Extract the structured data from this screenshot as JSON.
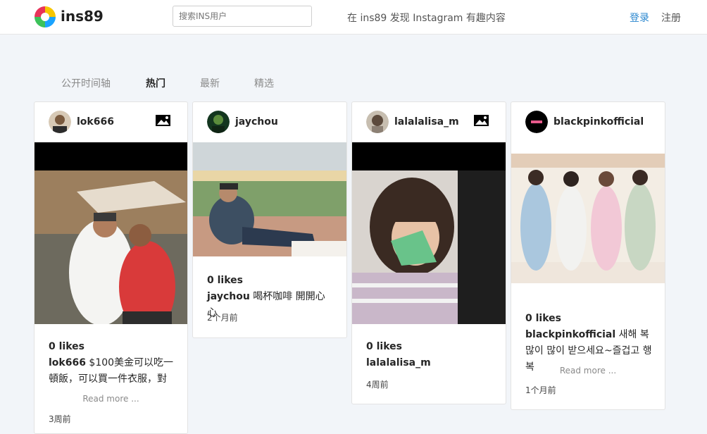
{
  "header": {
    "brand": "ins89",
    "search_placeholder": "搜索INS用户",
    "slogan": "在 ins89 发现 Instagram 有趣内容",
    "login": "登录",
    "register": "注册"
  },
  "tabs": [
    {
      "label": "公开时间轴",
      "active": false
    },
    {
      "label": "热门",
      "active": true
    },
    {
      "label": "最新",
      "active": false
    },
    {
      "label": "精选",
      "active": false
    }
  ],
  "posts": [
    {
      "username": "lok666",
      "likes": "0 likes",
      "caption_user": "lok666",
      "caption_text": "$100美金可以吃一頓飯，可以買一件衣服，對",
      "read_more": "Read more ...",
      "time": "3周前",
      "multi_image": true
    },
    {
      "username": "jaychou",
      "likes": "0 likes",
      "caption_user": "jaychou",
      "caption_text": "喝杯咖啡 開開心心",
      "time": "2个月前",
      "multi_image": false
    },
    {
      "username": "lalalalisa_m",
      "likes": "0 likes",
      "caption_user": "lalalalisa_m",
      "caption_text": "",
      "time": "4周前",
      "multi_image": true
    },
    {
      "username": "blackpinkofficial",
      "likes": "0 likes",
      "caption_user": "blackpinkofficial",
      "caption_text": "새해 복 많이 많이 받으세요~즐겁고 행복",
      "read_more": "Read more ...",
      "time": "1个月前",
      "multi_image": false
    }
  ],
  "colors": {
    "accent": "#2a87cf",
    "background": "#f2f5f9"
  }
}
